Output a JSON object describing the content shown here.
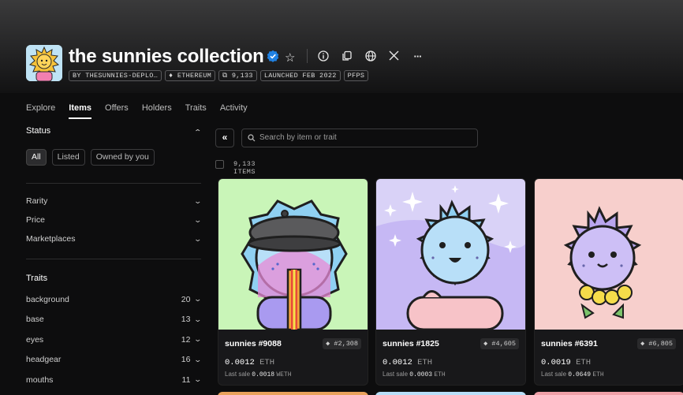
{
  "collection": {
    "title": "the sunnies collection",
    "tags": [
      "BY THESUNNIES-DEPLO…",
      "♦ ETHEREUM",
      "⧉ 9,133",
      "LAUNCHED FEB 2022",
      "PFPS"
    ]
  },
  "header_icons": [
    "verified-badge-icon",
    "star-icon",
    "info-icon",
    "copy-icon",
    "globe-icon",
    "x-logo-icon",
    "more-icon"
  ],
  "tabs": [
    "Explore",
    "Items",
    "Offers",
    "Holders",
    "Traits",
    "Activity"
  ],
  "active_tab": "Items",
  "sidebar": {
    "status_title": "Status",
    "status_chips": [
      "All",
      "Listed",
      "Owned by you"
    ],
    "filters": [
      "Rarity",
      "Price",
      "Marketplaces"
    ],
    "traits_title": "Traits",
    "traits": [
      {
        "label": "background",
        "count": "20"
      },
      {
        "label": "base",
        "count": "13"
      },
      {
        "label": "eyes",
        "count": "12"
      },
      {
        "label": "headgear",
        "count": "16"
      },
      {
        "label": "mouths",
        "count": "11"
      }
    ]
  },
  "search": {
    "placeholder": "Search by item or trait"
  },
  "items_count": "9,133 ITEMS",
  "cards": [
    {
      "name": "sunnies #9088",
      "rank": "#2,308",
      "price": "0.0012",
      "price_unit": "ETH",
      "last_label": "Last sale",
      "last_value": "0.0018",
      "last_unit": "WETH"
    },
    {
      "name": "sunnies #1825",
      "rank": "#4,605",
      "price": "0.0012",
      "price_unit": "ETH",
      "last_label": "Last sale",
      "last_value": "0.0003",
      "last_unit": "ETH"
    },
    {
      "name": "sunnies #6391",
      "rank": "#6,805",
      "price": "0.0019",
      "price_unit": "ETH",
      "last_label": "Last sale",
      "last_value": "0.0649",
      "last_unit": "ETH"
    }
  ],
  "colors": {
    "accent_verified": "#2081e2",
    "card1_bg": "#c9f5b8",
    "card2_bg": "#d9d2f7",
    "card3_bg": "#f7cfcc"
  }
}
